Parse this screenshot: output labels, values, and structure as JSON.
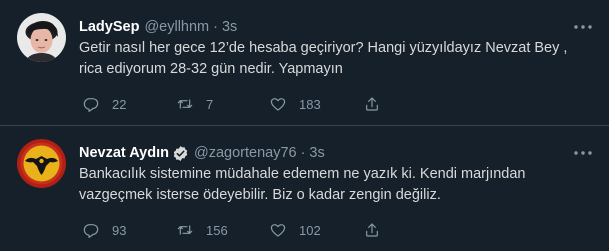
{
  "tweets": [
    {
      "display_name": "LadySep",
      "handle": "@eyllhnm",
      "separator": "·",
      "time": "3s",
      "verified": false,
      "lines": [
        "Getir nasıl her gece 12’de hesaba geçiriyor? Hangi yüzyıldayız Nevzat Bey ,",
        "rica ediyorum 28-32 gün nedir. Yapmayın"
      ],
      "counts": {
        "replies": "22",
        "retweets": "7",
        "likes": "183"
      }
    },
    {
      "display_name": "Nevzat Aydın",
      "handle": "@zagortenay76",
      "separator": "·",
      "time": "3s",
      "verified": true,
      "lines": [
        "Bankacılık sistemine müdahale edemem ne yazık ki. Kendi marjından",
        "vazgeçmek isterse ödeyebilir. Biz o kadar zengin değiliz."
      ],
      "counts": {
        "replies": "93",
        "retweets": "156",
        "likes": "102"
      }
    }
  ],
  "icons": {
    "more": "more-horizontal-icon",
    "reply": "reply-icon",
    "retweet": "retweet-icon",
    "like": "heart-icon",
    "share": "share-icon",
    "verified": "verified-badge-icon"
  },
  "colors": {
    "background": "#15202b",
    "divider": "#38444d",
    "name": "#ffffff",
    "secondary_text": "#8899a6",
    "body_text": "#d9d9d9",
    "verified_badge": "#d9d9d9"
  }
}
